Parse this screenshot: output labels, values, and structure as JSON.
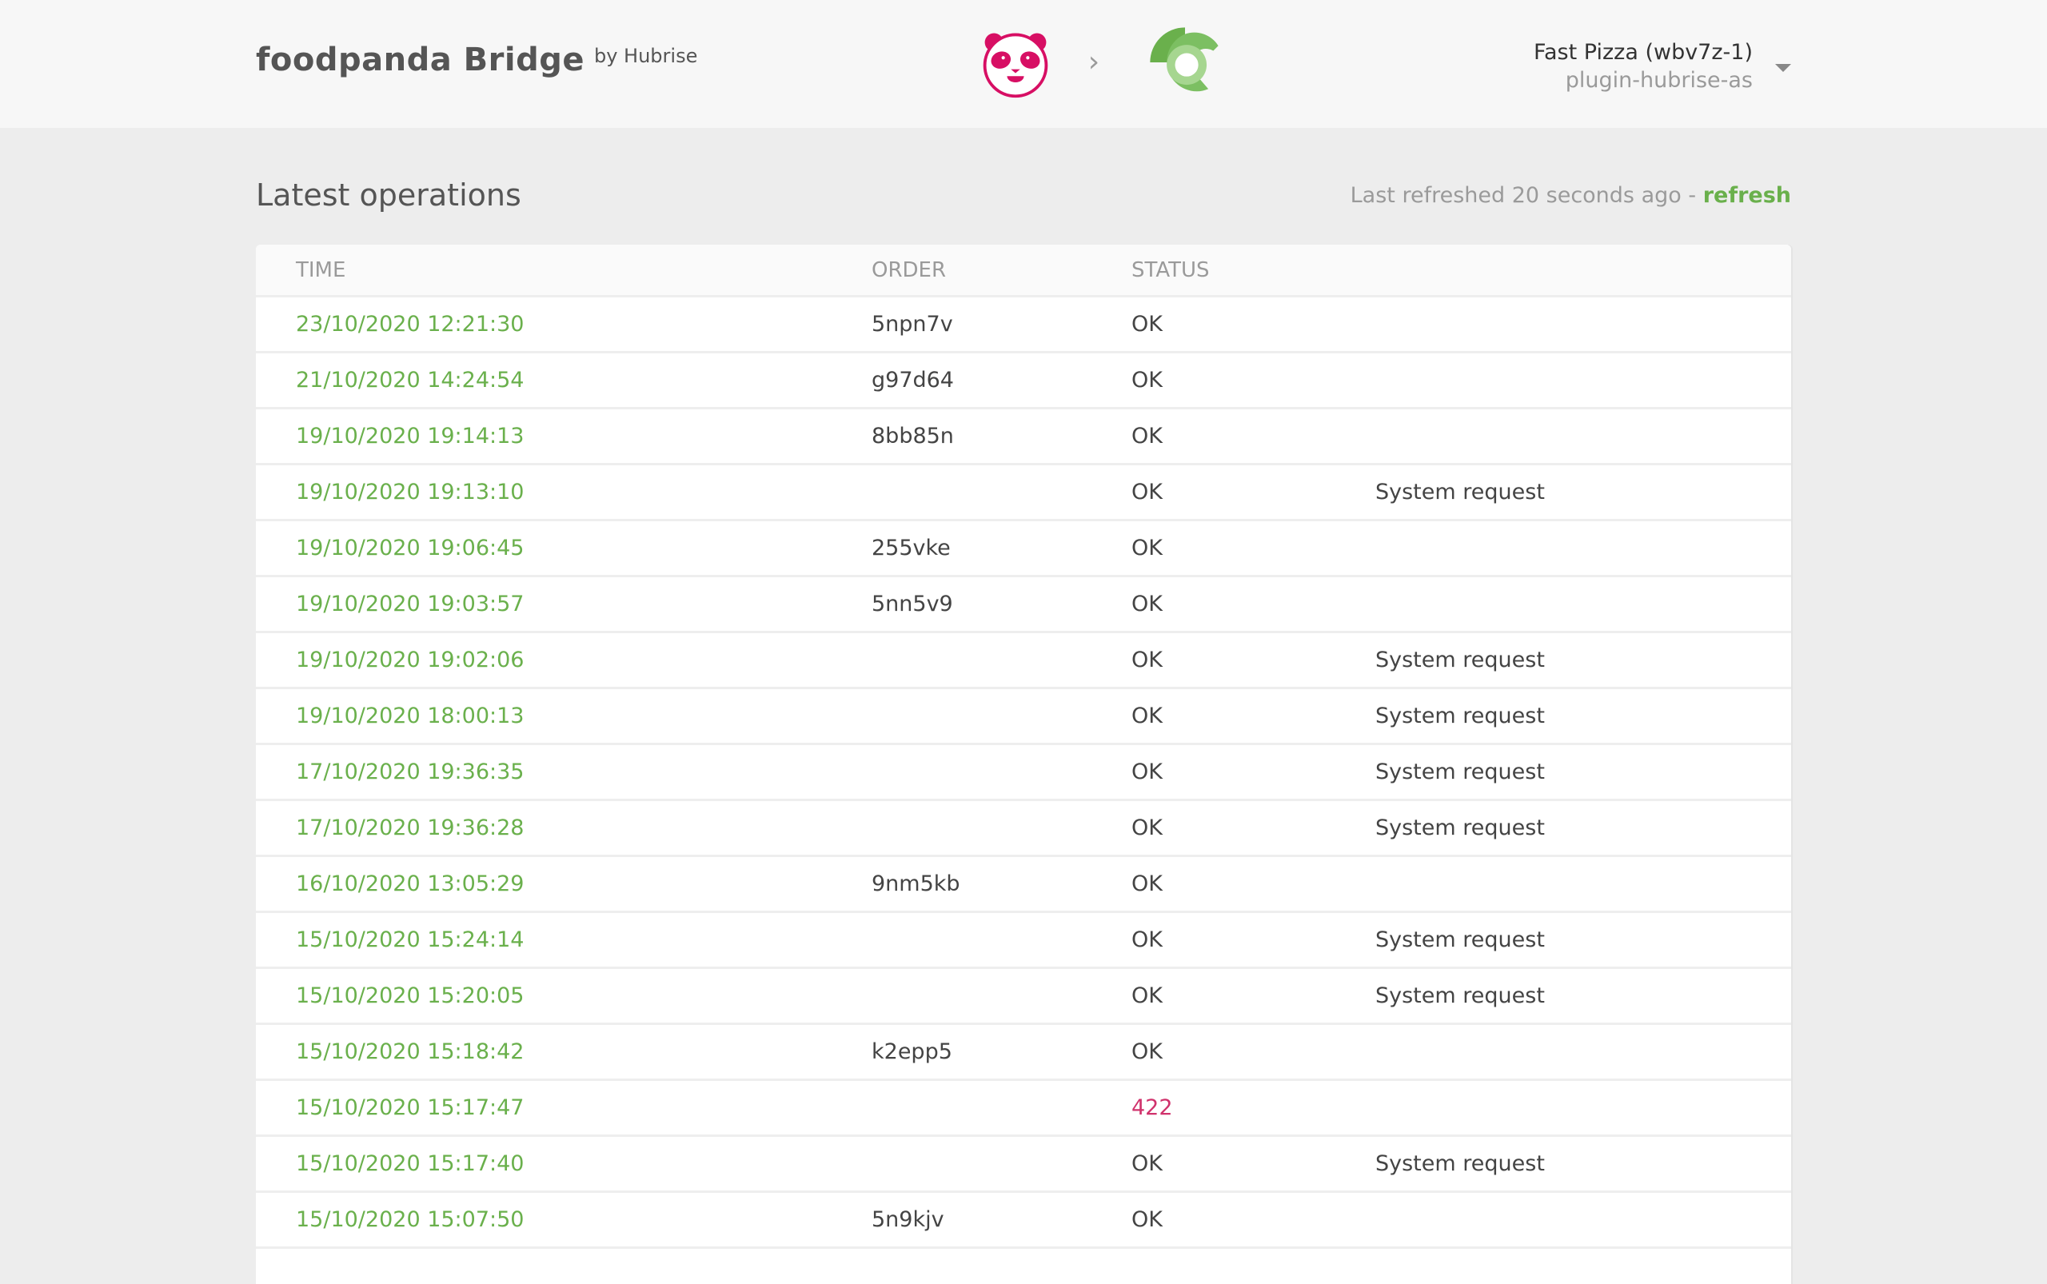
{
  "header": {
    "title": "foodpanda Bridge",
    "by_label": "by Hubrise",
    "source_logo": "foodpanda-logo-icon",
    "arrow": "›",
    "target_logo": "hubrise-logo-icon",
    "account_name": "Fast Pizza (wbv7z-1)",
    "account_sub": "plugin-hubrise-as",
    "colors": {
      "foodpanda": "#d70f64",
      "hubrise": "#6ab04c"
    }
  },
  "operations": {
    "title": "Latest operations",
    "refresh_text": "Last refreshed 20 seconds ago - ",
    "refresh_link": "refresh",
    "columns": [
      "TIME",
      "ORDER",
      "STATUS",
      ""
    ],
    "rows": [
      {
        "time": "23/10/2020 12:21:30",
        "order": "5npn7v",
        "status": "OK",
        "note": ""
      },
      {
        "time": "21/10/2020 14:24:54",
        "order": "g97d64",
        "status": "OK",
        "note": ""
      },
      {
        "time": "19/10/2020 19:14:13",
        "order": "8bb85n",
        "status": "OK",
        "note": ""
      },
      {
        "time": "19/10/2020 19:13:10",
        "order": "",
        "status": "OK",
        "note": "System request"
      },
      {
        "time": "19/10/2020 19:06:45",
        "order": "255vke",
        "status": "OK",
        "note": ""
      },
      {
        "time": "19/10/2020 19:03:57",
        "order": "5nn5v9",
        "status": "OK",
        "note": ""
      },
      {
        "time": "19/10/2020 19:02:06",
        "order": "",
        "status": "OK",
        "note": "System request"
      },
      {
        "time": "19/10/2020 18:00:13",
        "order": "",
        "status": "OK",
        "note": "System request"
      },
      {
        "time": "17/10/2020 19:36:35",
        "order": "",
        "status": "OK",
        "note": "System request"
      },
      {
        "time": "17/10/2020 19:36:28",
        "order": "",
        "status": "OK",
        "note": "System request"
      },
      {
        "time": "16/10/2020 13:05:29",
        "order": "9nm5kb",
        "status": "OK",
        "note": ""
      },
      {
        "time": "15/10/2020 15:24:14",
        "order": "",
        "status": "OK",
        "note": "System request"
      },
      {
        "time": "15/10/2020 15:20:05",
        "order": "",
        "status": "OK",
        "note": "System request"
      },
      {
        "time": "15/10/2020 15:18:42",
        "order": "k2epp5",
        "status": "OK",
        "note": ""
      },
      {
        "time": "15/10/2020 15:17:47",
        "order": "",
        "status": "422",
        "note": "",
        "error": true
      },
      {
        "time": "15/10/2020 15:17:40",
        "order": "",
        "status": "OK",
        "note": "System request"
      },
      {
        "time": "15/10/2020 15:07:50",
        "order": "5n9kjv",
        "status": "OK",
        "note": ""
      }
    ]
  }
}
